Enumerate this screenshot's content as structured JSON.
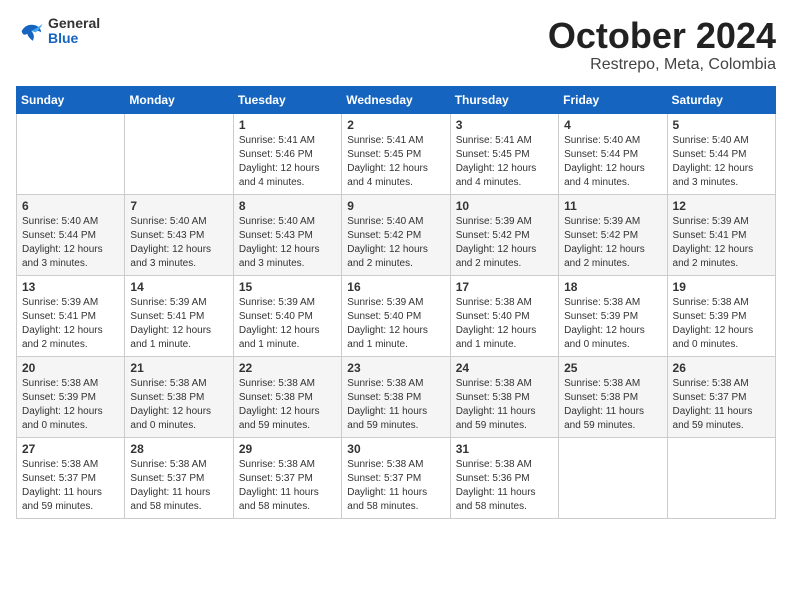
{
  "header": {
    "logo_general": "General",
    "logo_blue": "Blue",
    "month_title": "October 2024",
    "subtitle": "Restrepo, Meta, Colombia"
  },
  "days_of_week": [
    "Sunday",
    "Monday",
    "Tuesday",
    "Wednesday",
    "Thursday",
    "Friday",
    "Saturday"
  ],
  "weeks": [
    [
      {
        "day": "",
        "content": ""
      },
      {
        "day": "",
        "content": ""
      },
      {
        "day": "1",
        "content": "Sunrise: 5:41 AM\nSunset: 5:46 PM\nDaylight: 12 hours\nand 4 minutes."
      },
      {
        "day": "2",
        "content": "Sunrise: 5:41 AM\nSunset: 5:45 PM\nDaylight: 12 hours\nand 4 minutes."
      },
      {
        "day": "3",
        "content": "Sunrise: 5:41 AM\nSunset: 5:45 PM\nDaylight: 12 hours\nand 4 minutes."
      },
      {
        "day": "4",
        "content": "Sunrise: 5:40 AM\nSunset: 5:44 PM\nDaylight: 12 hours\nand 4 minutes."
      },
      {
        "day": "5",
        "content": "Sunrise: 5:40 AM\nSunset: 5:44 PM\nDaylight: 12 hours\nand 3 minutes."
      }
    ],
    [
      {
        "day": "6",
        "content": "Sunrise: 5:40 AM\nSunset: 5:44 PM\nDaylight: 12 hours\nand 3 minutes."
      },
      {
        "day": "7",
        "content": "Sunrise: 5:40 AM\nSunset: 5:43 PM\nDaylight: 12 hours\nand 3 minutes."
      },
      {
        "day": "8",
        "content": "Sunrise: 5:40 AM\nSunset: 5:43 PM\nDaylight: 12 hours\nand 3 minutes."
      },
      {
        "day": "9",
        "content": "Sunrise: 5:40 AM\nSunset: 5:42 PM\nDaylight: 12 hours\nand 2 minutes."
      },
      {
        "day": "10",
        "content": "Sunrise: 5:39 AM\nSunset: 5:42 PM\nDaylight: 12 hours\nand 2 minutes."
      },
      {
        "day": "11",
        "content": "Sunrise: 5:39 AM\nSunset: 5:42 PM\nDaylight: 12 hours\nand 2 minutes."
      },
      {
        "day": "12",
        "content": "Sunrise: 5:39 AM\nSunset: 5:41 PM\nDaylight: 12 hours\nand 2 minutes."
      }
    ],
    [
      {
        "day": "13",
        "content": "Sunrise: 5:39 AM\nSunset: 5:41 PM\nDaylight: 12 hours\nand 2 minutes."
      },
      {
        "day": "14",
        "content": "Sunrise: 5:39 AM\nSunset: 5:41 PM\nDaylight: 12 hours\nand 1 minute."
      },
      {
        "day": "15",
        "content": "Sunrise: 5:39 AM\nSunset: 5:40 PM\nDaylight: 12 hours\nand 1 minute."
      },
      {
        "day": "16",
        "content": "Sunrise: 5:39 AM\nSunset: 5:40 PM\nDaylight: 12 hours\nand 1 minute."
      },
      {
        "day": "17",
        "content": "Sunrise: 5:38 AM\nSunset: 5:40 PM\nDaylight: 12 hours\nand 1 minute."
      },
      {
        "day": "18",
        "content": "Sunrise: 5:38 AM\nSunset: 5:39 PM\nDaylight: 12 hours\nand 0 minutes."
      },
      {
        "day": "19",
        "content": "Sunrise: 5:38 AM\nSunset: 5:39 PM\nDaylight: 12 hours\nand 0 minutes."
      }
    ],
    [
      {
        "day": "20",
        "content": "Sunrise: 5:38 AM\nSunset: 5:39 PM\nDaylight: 12 hours\nand 0 minutes."
      },
      {
        "day": "21",
        "content": "Sunrise: 5:38 AM\nSunset: 5:38 PM\nDaylight: 12 hours\nand 0 minutes."
      },
      {
        "day": "22",
        "content": "Sunrise: 5:38 AM\nSunset: 5:38 PM\nDaylight: 12 hours\nand 59 minutes."
      },
      {
        "day": "23",
        "content": "Sunrise: 5:38 AM\nSunset: 5:38 PM\nDaylight: 11 hours\nand 59 minutes."
      },
      {
        "day": "24",
        "content": "Sunrise: 5:38 AM\nSunset: 5:38 PM\nDaylight: 11 hours\nand 59 minutes."
      },
      {
        "day": "25",
        "content": "Sunrise: 5:38 AM\nSunset: 5:38 PM\nDaylight: 11 hours\nand 59 minutes."
      },
      {
        "day": "26",
        "content": "Sunrise: 5:38 AM\nSunset: 5:37 PM\nDaylight: 11 hours\nand 59 minutes."
      }
    ],
    [
      {
        "day": "27",
        "content": "Sunrise: 5:38 AM\nSunset: 5:37 PM\nDaylight: 11 hours\nand 59 minutes."
      },
      {
        "day": "28",
        "content": "Sunrise: 5:38 AM\nSunset: 5:37 PM\nDaylight: 11 hours\nand 58 minutes."
      },
      {
        "day": "29",
        "content": "Sunrise: 5:38 AM\nSunset: 5:37 PM\nDaylight: 11 hours\nand 58 minutes."
      },
      {
        "day": "30",
        "content": "Sunrise: 5:38 AM\nSunset: 5:37 PM\nDaylight: 11 hours\nand 58 minutes."
      },
      {
        "day": "31",
        "content": "Sunrise: 5:38 AM\nSunset: 5:36 PM\nDaylight: 11 hours\nand 58 minutes."
      },
      {
        "day": "",
        "content": ""
      },
      {
        "day": "",
        "content": ""
      }
    ]
  ]
}
